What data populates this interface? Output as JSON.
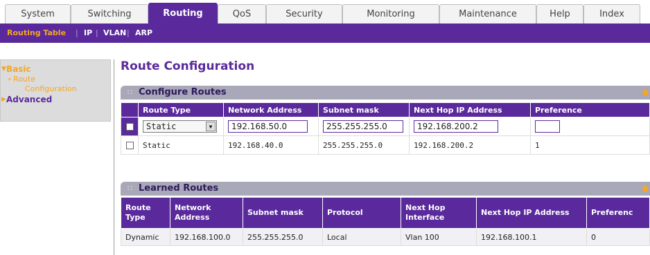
{
  "tabs": [
    {
      "label": "System"
    },
    {
      "label": "Switching"
    },
    {
      "label": "Routing"
    },
    {
      "label": "QoS"
    },
    {
      "label": "Security"
    },
    {
      "label": "Monitoring"
    },
    {
      "label": "Maintenance"
    },
    {
      "label": "Help"
    },
    {
      "label": "Index"
    }
  ],
  "subnav": {
    "items": [
      "Routing Table",
      "IP",
      "VLAN",
      "ARP"
    ],
    "active": "Routing Table"
  },
  "leftmenu": {
    "basic": "Basic",
    "route_line1": "Route",
    "route_line2": "Configuration",
    "advanced": "Advanced"
  },
  "page_title": "Route Configuration",
  "configure_routes": {
    "title": "Configure Routes",
    "headers": [
      "Route Type",
      "Network Address",
      "Subnet mask",
      "Next Hop IP Address",
      "Preference"
    ],
    "edit_row": {
      "route_type": "Static",
      "network_address": "192.168.50.0",
      "subnet_mask": "255.255.255.0",
      "next_hop": "192.168.200.2",
      "preference": ""
    },
    "rows": [
      {
        "route_type": "Static",
        "network_address": "192.168.40.0",
        "subnet_mask": "255.255.255.0",
        "next_hop": "192.168.200.2",
        "preference": "1"
      }
    ]
  },
  "learned_routes": {
    "title": "Learned Routes",
    "headers": [
      "Route Type",
      "Network Address",
      "Subnet mask",
      "Protocol",
      "Next Hop Interface",
      "Next Hop IP Address",
      "Preferenc"
    ],
    "rows": [
      {
        "route_type": "Dynamic",
        "network_address": "192.168.100.0",
        "subnet_mask": "255.255.255.0",
        "protocol": "Local",
        "next_hop_interface": "Vlan 100",
        "next_hop_ip": "192.168.100.1",
        "preference": "0"
      }
    ]
  },
  "colors": {
    "brand_purple": "#5a2a9c",
    "accent_orange": "#f5a623",
    "section_header": "#a8a8b8"
  }
}
